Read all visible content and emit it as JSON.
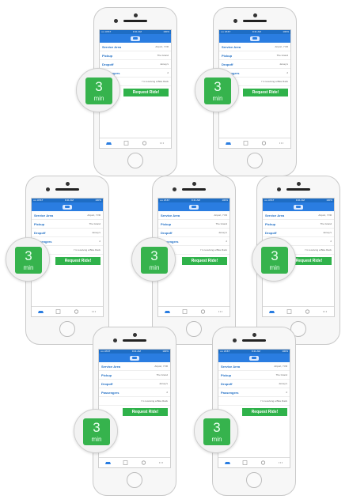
{
  "phone": {
    "status": {
      "carrier": "•••• AT&T",
      "time": "9:41 AM",
      "battery": "100%"
    },
    "rows": [
      {
        "label": "Service Area",
        "value": "Airport, YVR"
      },
      {
        "label": "Pickup",
        "value": "The Grand"
      },
      {
        "label": "Dropoff",
        "value": "Jersey's"
      },
      {
        "label": "Passengers",
        "value": "2"
      },
      {
        "label": "",
        "value": "I'm receiving a Bike Rack"
      }
    ],
    "request_button": "Request Ride!",
    "eta": {
      "number": "3",
      "unit": "min"
    },
    "tabs": [
      "Ride",
      "Schedule",
      "Settings",
      "More"
    ]
  },
  "colors": {
    "nav_blue": "#2a7de1",
    "status_blue": "#1e6dc4",
    "cta_green": "#2fb24a",
    "eta_green": "#36b34d"
  }
}
